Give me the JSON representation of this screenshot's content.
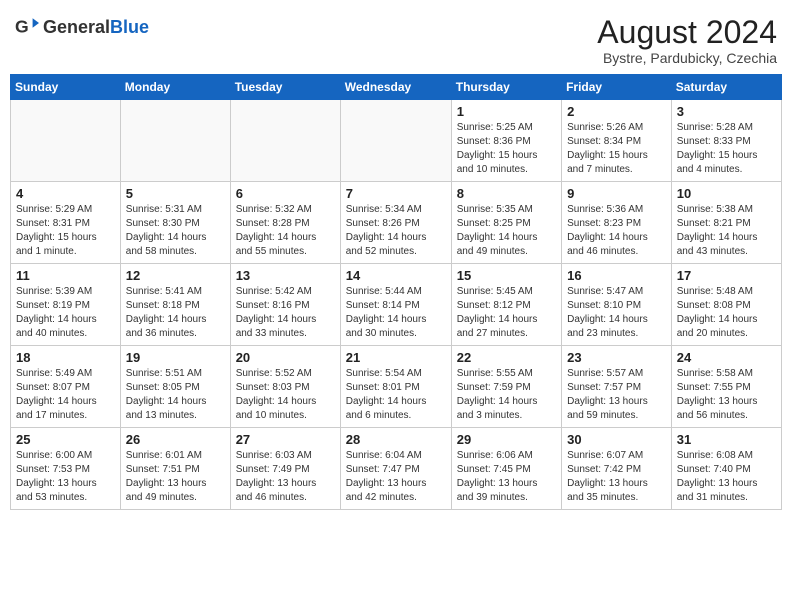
{
  "header": {
    "logo_general": "General",
    "logo_blue": "Blue",
    "month_title": "August 2024",
    "subtitle": "Bystre, Pardubicky, Czechia"
  },
  "calendar": {
    "headers": [
      "Sunday",
      "Monday",
      "Tuesday",
      "Wednesday",
      "Thursday",
      "Friday",
      "Saturday"
    ],
    "weeks": [
      [
        {
          "day": "",
          "info": ""
        },
        {
          "day": "",
          "info": ""
        },
        {
          "day": "",
          "info": ""
        },
        {
          "day": "",
          "info": ""
        },
        {
          "day": "1",
          "info": "Sunrise: 5:25 AM\nSunset: 8:36 PM\nDaylight: 15 hours\nand 10 minutes."
        },
        {
          "day": "2",
          "info": "Sunrise: 5:26 AM\nSunset: 8:34 PM\nDaylight: 15 hours\nand 7 minutes."
        },
        {
          "day": "3",
          "info": "Sunrise: 5:28 AM\nSunset: 8:33 PM\nDaylight: 15 hours\nand 4 minutes."
        }
      ],
      [
        {
          "day": "4",
          "info": "Sunrise: 5:29 AM\nSunset: 8:31 PM\nDaylight: 15 hours\nand 1 minute."
        },
        {
          "day": "5",
          "info": "Sunrise: 5:31 AM\nSunset: 8:30 PM\nDaylight: 14 hours\nand 58 minutes."
        },
        {
          "day": "6",
          "info": "Sunrise: 5:32 AM\nSunset: 8:28 PM\nDaylight: 14 hours\nand 55 minutes."
        },
        {
          "day": "7",
          "info": "Sunrise: 5:34 AM\nSunset: 8:26 PM\nDaylight: 14 hours\nand 52 minutes."
        },
        {
          "day": "8",
          "info": "Sunrise: 5:35 AM\nSunset: 8:25 PM\nDaylight: 14 hours\nand 49 minutes."
        },
        {
          "day": "9",
          "info": "Sunrise: 5:36 AM\nSunset: 8:23 PM\nDaylight: 14 hours\nand 46 minutes."
        },
        {
          "day": "10",
          "info": "Sunrise: 5:38 AM\nSunset: 8:21 PM\nDaylight: 14 hours\nand 43 minutes."
        }
      ],
      [
        {
          "day": "11",
          "info": "Sunrise: 5:39 AM\nSunset: 8:19 PM\nDaylight: 14 hours\nand 40 minutes."
        },
        {
          "day": "12",
          "info": "Sunrise: 5:41 AM\nSunset: 8:18 PM\nDaylight: 14 hours\nand 36 minutes."
        },
        {
          "day": "13",
          "info": "Sunrise: 5:42 AM\nSunset: 8:16 PM\nDaylight: 14 hours\nand 33 minutes."
        },
        {
          "day": "14",
          "info": "Sunrise: 5:44 AM\nSunset: 8:14 PM\nDaylight: 14 hours\nand 30 minutes."
        },
        {
          "day": "15",
          "info": "Sunrise: 5:45 AM\nSunset: 8:12 PM\nDaylight: 14 hours\nand 27 minutes."
        },
        {
          "day": "16",
          "info": "Sunrise: 5:47 AM\nSunset: 8:10 PM\nDaylight: 14 hours\nand 23 minutes."
        },
        {
          "day": "17",
          "info": "Sunrise: 5:48 AM\nSunset: 8:08 PM\nDaylight: 14 hours\nand 20 minutes."
        }
      ],
      [
        {
          "day": "18",
          "info": "Sunrise: 5:49 AM\nSunset: 8:07 PM\nDaylight: 14 hours\nand 17 minutes."
        },
        {
          "day": "19",
          "info": "Sunrise: 5:51 AM\nSunset: 8:05 PM\nDaylight: 14 hours\nand 13 minutes."
        },
        {
          "day": "20",
          "info": "Sunrise: 5:52 AM\nSunset: 8:03 PM\nDaylight: 14 hours\nand 10 minutes."
        },
        {
          "day": "21",
          "info": "Sunrise: 5:54 AM\nSunset: 8:01 PM\nDaylight: 14 hours\nand 6 minutes."
        },
        {
          "day": "22",
          "info": "Sunrise: 5:55 AM\nSunset: 7:59 PM\nDaylight: 14 hours\nand 3 minutes."
        },
        {
          "day": "23",
          "info": "Sunrise: 5:57 AM\nSunset: 7:57 PM\nDaylight: 13 hours\nand 59 minutes."
        },
        {
          "day": "24",
          "info": "Sunrise: 5:58 AM\nSunset: 7:55 PM\nDaylight: 13 hours\nand 56 minutes."
        }
      ],
      [
        {
          "day": "25",
          "info": "Sunrise: 6:00 AM\nSunset: 7:53 PM\nDaylight: 13 hours\nand 53 minutes."
        },
        {
          "day": "26",
          "info": "Sunrise: 6:01 AM\nSunset: 7:51 PM\nDaylight: 13 hours\nand 49 minutes."
        },
        {
          "day": "27",
          "info": "Sunrise: 6:03 AM\nSunset: 7:49 PM\nDaylight: 13 hours\nand 46 minutes."
        },
        {
          "day": "28",
          "info": "Sunrise: 6:04 AM\nSunset: 7:47 PM\nDaylight: 13 hours\nand 42 minutes."
        },
        {
          "day": "29",
          "info": "Sunrise: 6:06 AM\nSunset: 7:45 PM\nDaylight: 13 hours\nand 39 minutes."
        },
        {
          "day": "30",
          "info": "Sunrise: 6:07 AM\nSunset: 7:42 PM\nDaylight: 13 hours\nand 35 minutes."
        },
        {
          "day": "31",
          "info": "Sunrise: 6:08 AM\nSunset: 7:40 PM\nDaylight: 13 hours\nand 31 minutes."
        }
      ]
    ]
  }
}
